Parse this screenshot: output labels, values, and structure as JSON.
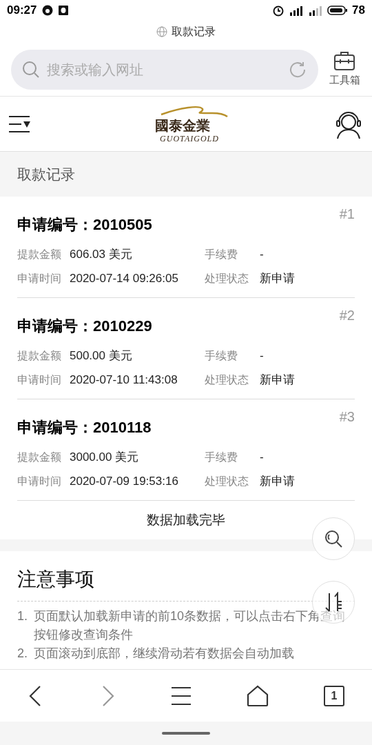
{
  "status_bar": {
    "time": "09:27",
    "battery": "78"
  },
  "browser": {
    "page_title": "取款记录",
    "search": {
      "placeholder": "搜索或输入网址"
    },
    "toolbox_label": "工具箱"
  },
  "site_header": {
    "brand_name": "國泰金業",
    "brand_latin": "GUOTAIGOLD"
  },
  "section_title": "取款记录",
  "records": [
    {
      "title": "申请编号：2010505",
      "index": "#1",
      "fields": [
        {
          "label": "提款金额",
          "value": "606.03 美元"
        },
        {
          "label": "手续费",
          "value": "-"
        },
        {
          "label": "申请时间",
          "value": "2020-07-14 09:26:05"
        },
        {
          "label": "处理状态",
          "value": "新申请"
        }
      ]
    },
    {
      "title": "申请编号：2010229",
      "index": "#2",
      "fields": [
        {
          "label": "提款金额",
          "value": "500.00 美元"
        },
        {
          "label": "手续费",
          "value": "-"
        },
        {
          "label": "申请时间",
          "value": "2020-07-10 11:43:08"
        },
        {
          "label": "处理状态",
          "value": "新申请"
        }
      ]
    },
    {
      "title": "申请编号：2010118",
      "index": "#3",
      "fields": [
        {
          "label": "提款金额",
          "value": "3000.00 美元"
        },
        {
          "label": "手续费",
          "value": "-"
        },
        {
          "label": "申请时间",
          "value": "2020-07-09 19:53:16"
        },
        {
          "label": "处理状态",
          "value": "新申请"
        }
      ]
    }
  ],
  "load_status": "数据加载完毕",
  "notes": {
    "title": "注意事项",
    "items": [
      {
        "number": "1.",
        "text": "页面默认加载新申请的前10条数据，可以点击右下角查询按钮修改查询条件"
      },
      {
        "number": "2.",
        "text": "页面滚动到底部，继续滑动若有数据会自动加载"
      }
    ]
  },
  "tabs_count": "1"
}
